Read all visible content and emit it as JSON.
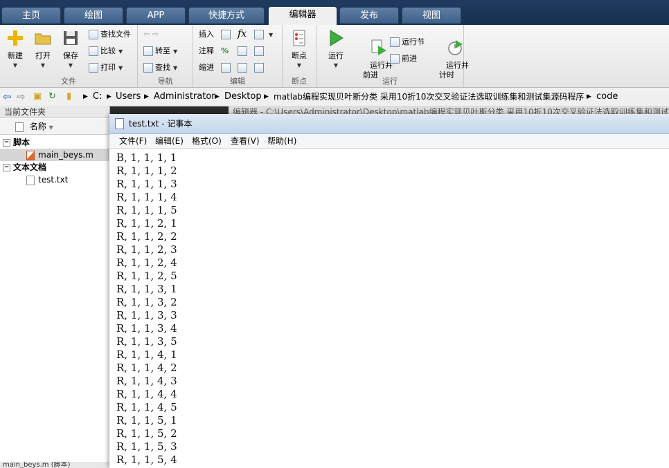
{
  "tabs": [
    "主页",
    "绘图",
    "APP",
    "快捷方式",
    "编辑器",
    "发布",
    "视图"
  ],
  "active_tab": "编辑器",
  "ribbon": {
    "file_group": {
      "label": "文件",
      "new": "新建",
      "open": "打开",
      "save": "保存",
      "find_files": "查找文件",
      "compare": "比较",
      "print": "打印"
    },
    "nav_group": {
      "label": "导航",
      "goto": "转至",
      "find": "查找"
    },
    "edit_group": {
      "label": "编辑",
      "insert": "插入",
      "comment": "注释",
      "indent": "缩进",
      "fx": "fx",
      "percent": "%"
    },
    "breakpoint_group": {
      "label": "断点",
      "breakpoints": "断点"
    },
    "run_group": {
      "label": "运行",
      "run": "运行",
      "run_advance": "运行并\n前进",
      "run_section": "运行节",
      "advance": "前进",
      "run_time": "运行并\n计时"
    }
  },
  "address": {
    "crumbs": [
      "C:",
      "Users",
      "Administrator",
      "Desktop",
      "matlab编程实现贝叶斯分类 采用10折10次交叉验证法选取训练集和测试集源码程序",
      "code"
    ]
  },
  "current_folder": {
    "title": "当前文件夹",
    "column_name": "名称",
    "groups": [
      {
        "label": "脚本",
        "files": [
          "main_beys.m"
        ]
      },
      {
        "label": "文本文档",
        "files": [
          "test.txt"
        ]
      }
    ],
    "status": "main_beys.m (脚本)"
  },
  "editor_bar": "编辑器 - C:\\Users\\Administrator\\Desktop\\matlab编程实现贝叶斯分类 采用10折10次交叉验证法选取训练集和测试",
  "notepad": {
    "title": "test.txt - 记事本",
    "menu": [
      "文件(F)",
      "编辑(E)",
      "格式(O)",
      "查看(V)",
      "帮助(H)"
    ],
    "lines": [
      "B, 1, 1, 1, 1",
      "R, 1, 1, 1, 2",
      "R, 1, 1, 1, 3",
      "R, 1, 1, 1, 4",
      "R, 1, 1, 1, 5",
      "R, 1, 1, 2, 1",
      "R, 1, 1, 2, 2",
      "R, 1, 1, 2, 3",
      "R, 1, 1, 2, 4",
      "R, 1, 1, 2, 5",
      "R, 1, 1, 3, 1",
      "R, 1, 1, 3, 2",
      "R, 1, 1, 3, 3",
      "R, 1, 1, 3, 4",
      "R, 1, 1, 3, 5",
      "R, 1, 1, 4, 1",
      "R, 1, 1, 4, 2",
      "R, 1, 1, 4, 3",
      "R, 1, 1, 4, 4",
      "R, 1, 1, 4, 5",
      "R, 1, 1, 5, 1",
      "R, 1, 1, 5, 2",
      "R, 1, 1, 5, 3",
      "R, 1, 1, 5, 4"
    ]
  },
  "colors": {
    "tabbar": "#1f3c5f",
    "run_green": "#3fae3f"
  }
}
